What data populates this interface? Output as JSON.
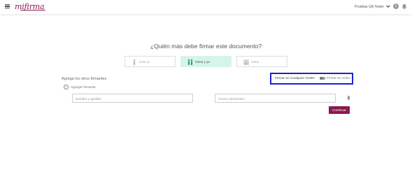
{
  "header": {
    "logo_text": "mifirma",
    "user_name": "Pruebas QA Tester",
    "icons": [
      "menu-icon",
      "chevron-down-icon",
      "info-icon",
      "bell-icon"
    ]
  },
  "main": {
    "title": "¿Quién más debe firmar este documento?",
    "options": [
      {
        "label": "Solo yo",
        "icon": "single-person-icon",
        "active": false
      },
      {
        "label": "Otros y yo",
        "icon": "people-group-icon",
        "active": true
      },
      {
        "label": "Otros",
        "icon": "people-others-icon",
        "active": false
      }
    ],
    "add_signers_title": "Agrega los otros firmantes",
    "order": {
      "any_order_label": "Firmar en Cualquier Orden",
      "in_order_label": "Firmar en orden"
    },
    "add_signer_label": "Agregar firmante",
    "name_placeholder": "Nombre y apellido",
    "email_placeholder": "Correo electrónico",
    "continue_label": "Continuar"
  },
  "colors": {
    "brand": "#8a1a4f",
    "active_option": "#d6f5ea",
    "highlight_box": "#1f1fd6"
  }
}
